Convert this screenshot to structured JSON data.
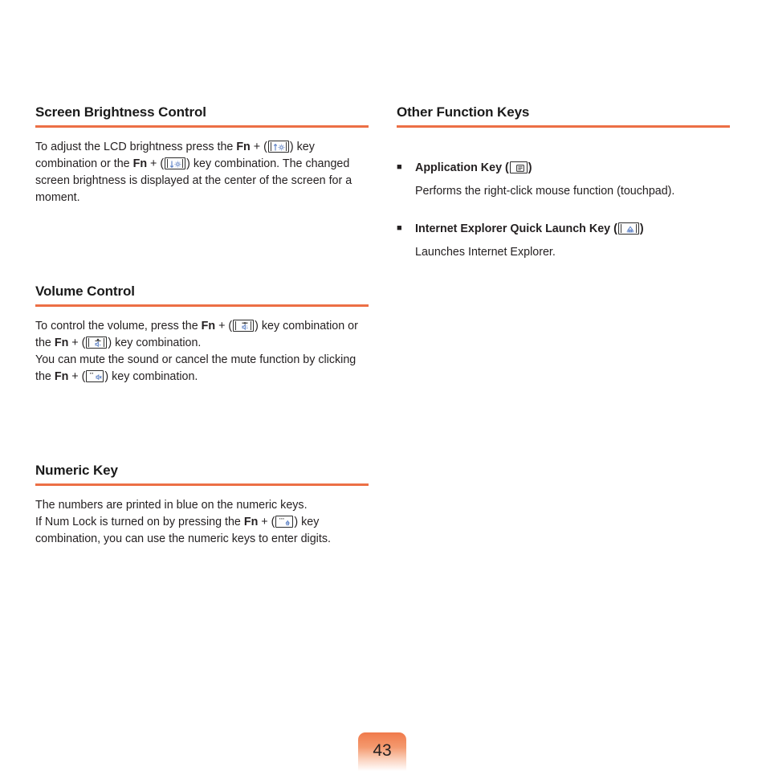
{
  "document": {
    "page_number": "43"
  },
  "left_column": {
    "sections": [
      {
        "title": "Screen Brightness Control",
        "paragraph_parts": {
          "p1": "To adjust the LCD brightness press the ",
          "fn1": "Fn",
          "p2": " + (",
          "key1_name": "brightness-up-key-icon",
          "p3": ") key combination or the ",
          "fn2": "Fn",
          "p4": " + (",
          "key2_name": "brightness-down-key-icon",
          "p5": ") key combination. The changed screen brightness is displayed at the center of the screen for a moment."
        }
      },
      {
        "title": "Volume Control",
        "paragraph_parts": {
          "p1": "To control the volume, press the ",
          "fn1": "Fn",
          "p2": " + (",
          "key1_name": "volume-up-key-icon",
          "p3": ") key combination or the ",
          "fn2": "Fn",
          "p4": " + (",
          "key2_name": "volume-down-key-icon",
          "p5": ") key combination.",
          "p6": "You can mute the sound or cancel the mute function by clicking the ",
          "fn3": "Fn",
          "p7": " + (",
          "key3_name": "mute-key-icon",
          "p8": ") key combination."
        }
      },
      {
        "title": "Numeric Key",
        "paragraph_parts": {
          "p1": "The numbers are printed in blue on the numeric keys.",
          "p2": "If Num Lock is turned on by pressing the ",
          "fn1": "Fn",
          "p3": " + (",
          "key1_name": "num-lock-key-icon",
          "p4": ") key combination, you can use the numeric keys to enter digits."
        }
      }
    ]
  },
  "right_column": {
    "section_title": "Other Function Keys",
    "bullets": [
      {
        "marker": "■",
        "label_before": "Application Key (",
        "key_name": "application-key-icon",
        "label_after": ")",
        "description": "Performs the right-click mouse function (touchpad)."
      },
      {
        "marker": "■",
        "label_before": "Internet Explorer Quick Launch Key (",
        "key_name": "internet-explorer-key-icon",
        "label_after": ")",
        "description": "Launches Internet Explorer."
      }
    ]
  },
  "colors": {
    "accent_rule": "#ec6f45",
    "badge_top": "#f07a4b",
    "body_text": "#231f20",
    "key_glyph_blue": "#5a7fc4"
  }
}
